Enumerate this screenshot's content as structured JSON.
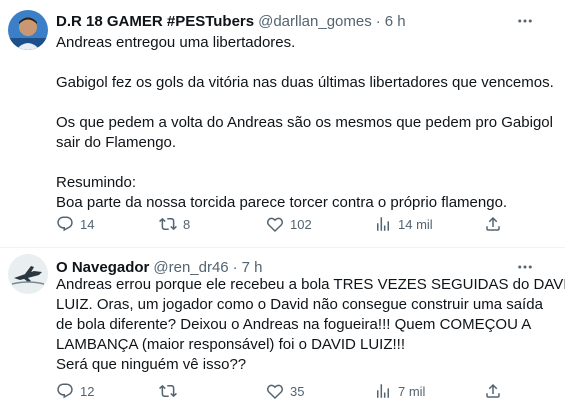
{
  "tweets": [
    {
      "author": "D.R 18 GAMER #PESTubers",
      "handle": "@darllan_gomes",
      "separator": "·",
      "time": "6 h",
      "lines": [
        [
          "Andreas entregou uma libertadores."
        ],
        [
          "Gabigol fez os gols da vitória nas duas últimas libertadores que vencemos."
        ],
        [
          "Os que pedem a volta do Andreas são os mesmos que pedem pro Gabigol",
          "sair do Flamengo."
        ],
        [
          "Resumindo:",
          "Boa parte da nossa torcida parece torcer contra o próprio flamengo."
        ]
      ],
      "replies": "14",
      "retweets": "8",
      "likes": "102",
      "views": "14 mil"
    },
    {
      "author": "O Navegador",
      "handle": "@ren_dr46",
      "separator": "·",
      "time": "7 h",
      "lines": [
        [
          "Andreas errou porque ele recebeu a bola TRES VEZES SEGUIDAS do DAVID",
          "LUIZ. Oras, um jogador como o David não consegue construir uma saída",
          "de bola diferente? Deixou o Andreas na fogueira!!! Quem COMEÇOU A",
          "LAMBANÇA (maior responsável) foi o DAVID LUIZ!!!",
          "Será que ninguém vê isso??"
        ]
      ],
      "replies": "12",
      "retweets": "",
      "likes": "35",
      "views": "7 mil"
    }
  ],
  "colors": {
    "text": "#0f1419",
    "secondary": "#536471",
    "divider": "#eff3f4"
  },
  "icons": [
    "more-icon",
    "reply-icon",
    "retweet-icon",
    "like-icon",
    "views-icon",
    "share-icon"
  ]
}
